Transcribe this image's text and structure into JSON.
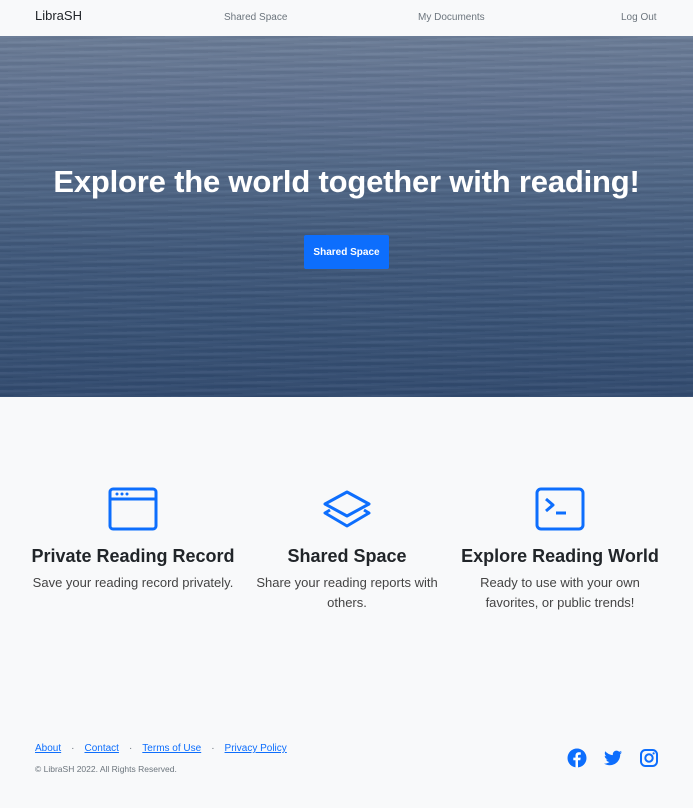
{
  "navbar": {
    "brand": "LibraSH",
    "links": [
      {
        "label": "Shared Space"
      },
      {
        "label": "My Documents"
      },
      {
        "label": "Log Out"
      }
    ]
  },
  "hero": {
    "title": "Explore the world together with reading!",
    "button_label": "Shared Space"
  },
  "features": [
    {
      "icon": "window-icon",
      "title": "Private Reading Record",
      "description": "Save your reading record privately."
    },
    {
      "icon": "layers-icon",
      "title": "Shared Space",
      "description": "Share your reading reports with others."
    },
    {
      "icon": "terminal-icon",
      "title": "Explore Reading World",
      "description": "Ready to use with your own favorites, or public trends!"
    }
  ],
  "footer": {
    "links": [
      {
        "label": "About"
      },
      {
        "label": "Contact"
      },
      {
        "label": "Terms of Use"
      },
      {
        "label": "Privacy Policy"
      }
    ],
    "separator": "·",
    "copyright": "© LibraSH 2022. All Rights Reserved.",
    "social": [
      "facebook-icon",
      "twitter-icon",
      "instagram-icon"
    ]
  },
  "colors": {
    "accent": "#0d6efd",
    "background": "#f8f9fa",
    "text": "#212529"
  }
}
